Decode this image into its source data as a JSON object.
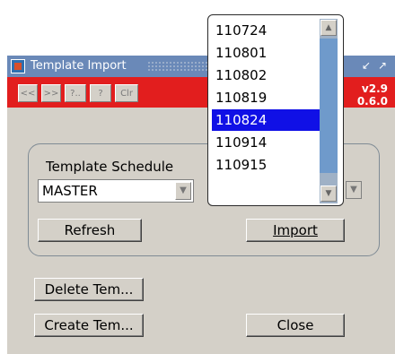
{
  "window": {
    "title": "Template Import",
    "icons": {
      "app": "template-import-icon",
      "minimize": "minimize-icon",
      "restore": "restore-icon"
    }
  },
  "toolbar": {
    "buttons": [
      "<<",
      ">>",
      "?..",
      "?",
      "Clr"
    ],
    "version_line1": "v2.9",
    "version_line2": "0.6.0",
    "colors": {
      "toolbar_bg": "#e21e1e"
    }
  },
  "template_schedule": {
    "label": "Template Schedule",
    "selected": "MASTER"
  },
  "dropdown": {
    "options": [
      "110724",
      "110801",
      "110802",
      "110819",
      "110824",
      "110914",
      "110915"
    ],
    "selected": "110824",
    "colors": {
      "selection": "#1010e6"
    }
  },
  "buttons": {
    "refresh": "Refresh",
    "import": "Import",
    "delete": "Delete Tem...",
    "create": "Create Tem...",
    "close": "Close"
  }
}
